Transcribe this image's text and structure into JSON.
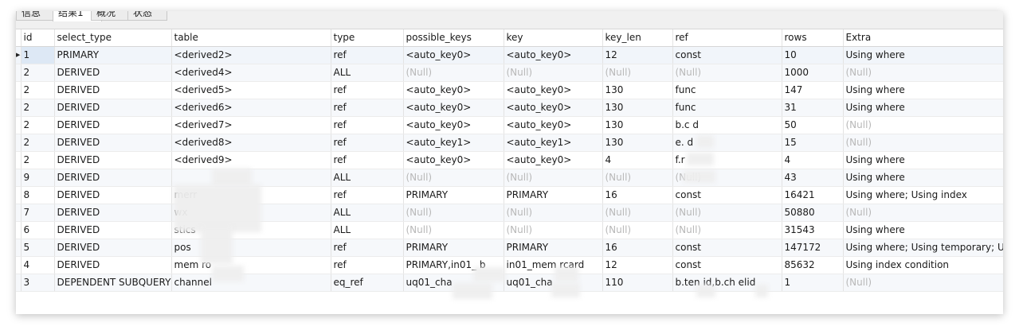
{
  "tabs": [
    {
      "label": "信息",
      "active": false
    },
    {
      "label": "结果1",
      "active": true
    },
    {
      "label": "概况",
      "active": false
    },
    {
      "label": "状态",
      "active": false
    }
  ],
  "columns": [
    "id",
    "select_type",
    "table",
    "type",
    "possible_keys",
    "key",
    "key_len",
    "ref",
    "rows",
    "Extra"
  ],
  "rows": [
    [
      "1",
      "PRIMARY",
      "<derived2>",
      "ref",
      "<auto_key0>",
      "<auto_key0>",
      "12",
      "const",
      "10",
      "Using where"
    ],
    [
      "2",
      "DERIVED",
      "<derived4>",
      "ALL",
      "(Null)",
      "(Null)",
      "(Null)",
      "(Null)",
      "1000",
      "(Null)"
    ],
    [
      "2",
      "DERIVED",
      "<derived5>",
      "ref",
      "<auto_key0>",
      "<auto_key0>",
      "130",
      "func",
      "147",
      "Using where"
    ],
    [
      "2",
      "DERIVED",
      "<derived6>",
      "ref",
      "<auto_key0>",
      "<auto_key0>",
      "130",
      "func",
      "31",
      "Using where"
    ],
    [
      "2",
      "DERIVED",
      "<derived7>",
      "ref",
      "<auto_key0>",
      "<auto_key0>",
      "130",
      "b.c    d",
      "50",
      "(Null)"
    ],
    [
      "2",
      "DERIVED",
      "<derived8>",
      "ref",
      "<auto_key1>",
      "<auto_key1>",
      "130",
      "e.    d",
      "15",
      "(Null)"
    ],
    [
      "2",
      "DERIVED",
      "<derived9>",
      "ref",
      "<auto_key0>",
      "<auto_key0>",
      "4",
      "f.r",
      "4",
      "Using where"
    ],
    [
      "9",
      "DERIVED",
      "",
      "ALL",
      "(Null)",
      "(Null)",
      "(Null)",
      "(Null)",
      "43",
      "Using where"
    ],
    [
      "8",
      "DERIVED",
      "   merr",
      "ref",
      "PRIMARY",
      "PRIMARY",
      "16",
      "const",
      "16421",
      "Using where; Using index"
    ],
    [
      "7",
      "DERIVED",
      "wx",
      "ALL",
      "(Null)",
      "(Null)",
      "(Null)",
      "(Null)",
      "50880",
      "(Null)"
    ],
    [
      "6",
      "DERIVED",
      "                          stics",
      "ALL",
      "(Null)",
      "(Null)",
      "(Null)",
      "(Null)",
      "31543",
      "Using where"
    ],
    [
      "5",
      "DERIVED",
      "pos",
      "ref",
      "PRIMARY",
      "PRIMARY",
      "16",
      "const",
      "147172",
      "Using where; Using temporary; Us"
    ],
    [
      "4",
      "DERIVED",
      "mem   ro",
      "ref",
      "PRIMARY,in01_    b",
      "in01_mem   rcard",
      "12",
      "const",
      "85632",
      "Using index condition"
    ],
    [
      "3",
      "DEPENDENT SUBQUERY",
      "channel",
      "eq_ref",
      "uq01_cha",
      "uq01_cha",
      "110",
      "b.ten    id,b.ch    elid",
      "1",
      "(Null)"
    ]
  ],
  "current_row_indicator": "▶",
  "colors": {
    "alt_row": "#f6f8fb",
    "selected_cell": "#dde8f5",
    "null_text": "#b8b8b8",
    "grid_line": "#e3e3e3"
  }
}
